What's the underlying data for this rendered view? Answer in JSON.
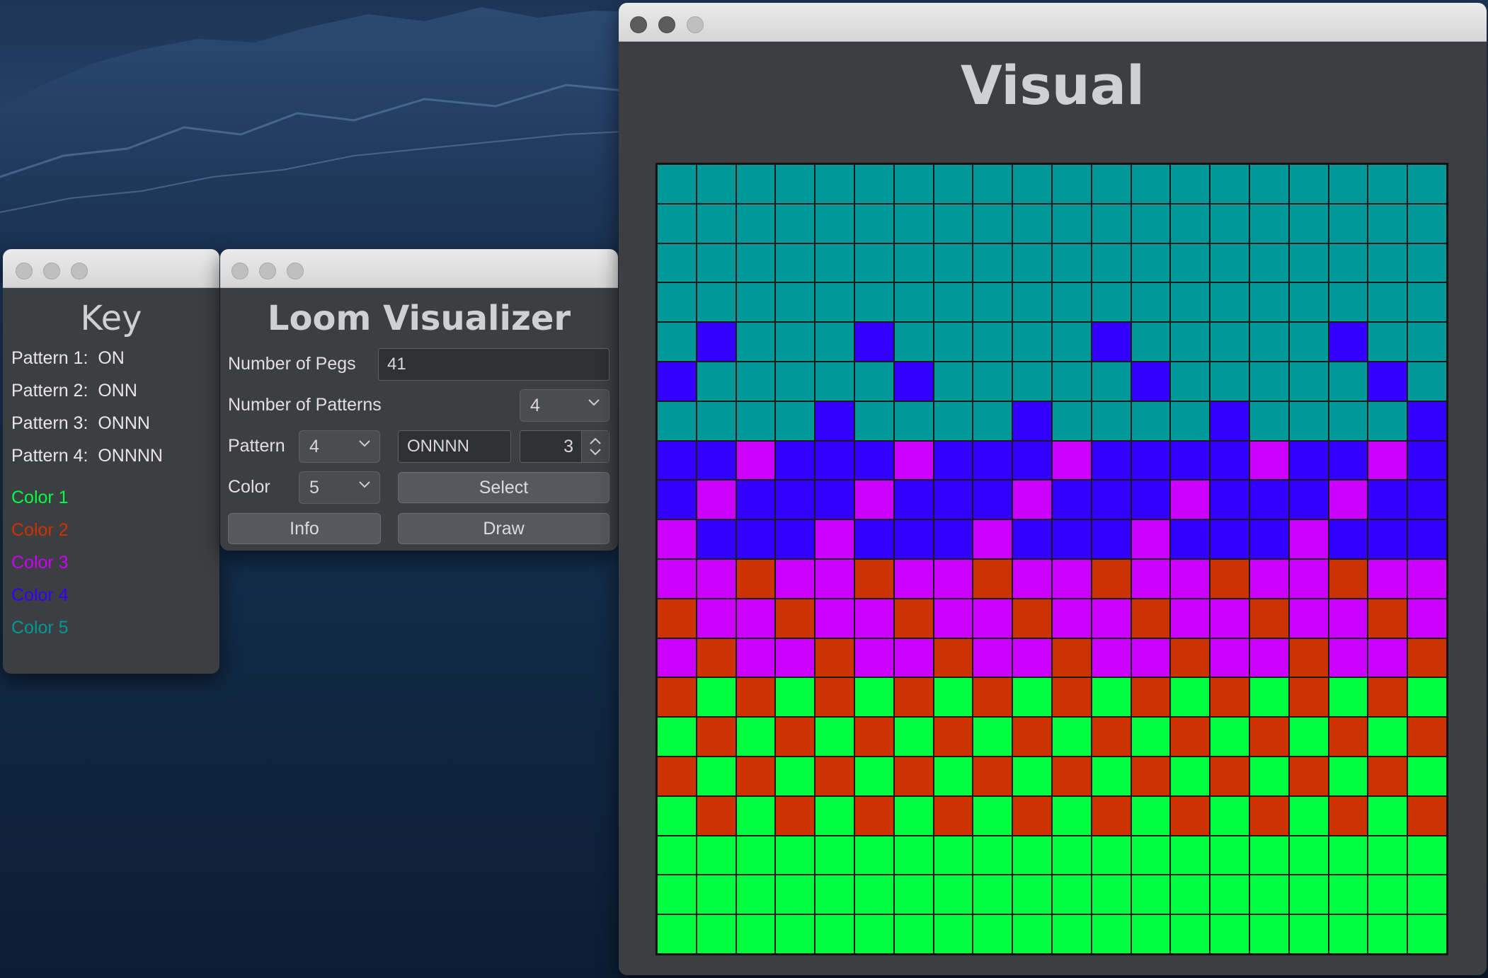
{
  "key_window": {
    "title": "Key",
    "patterns": [
      {
        "label": "Pattern 1:",
        "value": "ON"
      },
      {
        "label": "Pattern 2:",
        "value": "ONN"
      },
      {
        "label": "Pattern 3:",
        "value": "ONNN"
      },
      {
        "label": "Pattern 4:",
        "value": "ONNNN"
      }
    ],
    "colors": [
      {
        "label": "Color 1",
        "hex": "#00ff40"
      },
      {
        "label": "Color 2",
        "hex": "#cc3300"
      },
      {
        "label": "Color 3",
        "hex": "#cc00ff"
      },
      {
        "label": "Color 4",
        "hex": "#3300ff"
      },
      {
        "label": "Color 5",
        "hex": "#009999"
      }
    ]
  },
  "loom_window": {
    "title": "Loom Visualizer",
    "pegs_label": "Number of Pegs",
    "pegs_value": "41",
    "patterns_label": "Number of Patterns",
    "patterns_value": "4",
    "pattern_label": "Pattern",
    "pattern_select": "4",
    "pattern_text": "ONNNN",
    "pattern_stepper": "3",
    "color_label": "Color",
    "color_select": "5",
    "select_button": "Select",
    "info_button": "Info",
    "draw_button": "Draw"
  },
  "visual_window": {
    "title": "Visual",
    "grid_columns": 20,
    "grid_rows": 20,
    "palette": {
      "1": "#00ff40",
      "2": "#cc3300",
      "3": "#cc00ff",
      "4": "#3300ff",
      "5": "#009999"
    },
    "rows": [
      "55555555555555555555",
      "55555555555555555555",
      "55555555555555555555",
      "55555555555555555555",
      "54555455555455555455",
      "45555545555545555545",
      "55554555545555455554",
      "44344434443444434434",
      "43444344434443444344",
      "34443444344434443444",
      "33233233233233233233",
      "23323323323323323323",
      "32332332332332332332",
      "21212121212121212121",
      "12121212121212121212",
      "21212121212121212121",
      "12121212121212121212",
      "11111111111111111111",
      "11111111111111111111",
      "11111111111111111111"
    ]
  }
}
